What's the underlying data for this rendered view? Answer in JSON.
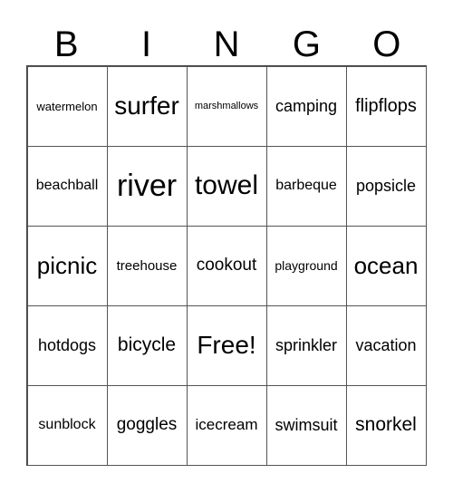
{
  "header": [
    "B",
    "I",
    "N",
    "G",
    "O"
  ],
  "cells": [
    "watermelon",
    "surfer",
    "marshmallows",
    "camping",
    "flipflops",
    "beachball",
    "river",
    "towel",
    "barbeque",
    "popsicle",
    "picnic",
    "treehouse",
    "cookout",
    "playground",
    "ocean",
    "hotdogs",
    "bicycle",
    "Free!",
    "sprinkler",
    "vacation",
    "sunblock",
    "goggles",
    "icecream",
    "swimsuit",
    "snorkel"
  ]
}
